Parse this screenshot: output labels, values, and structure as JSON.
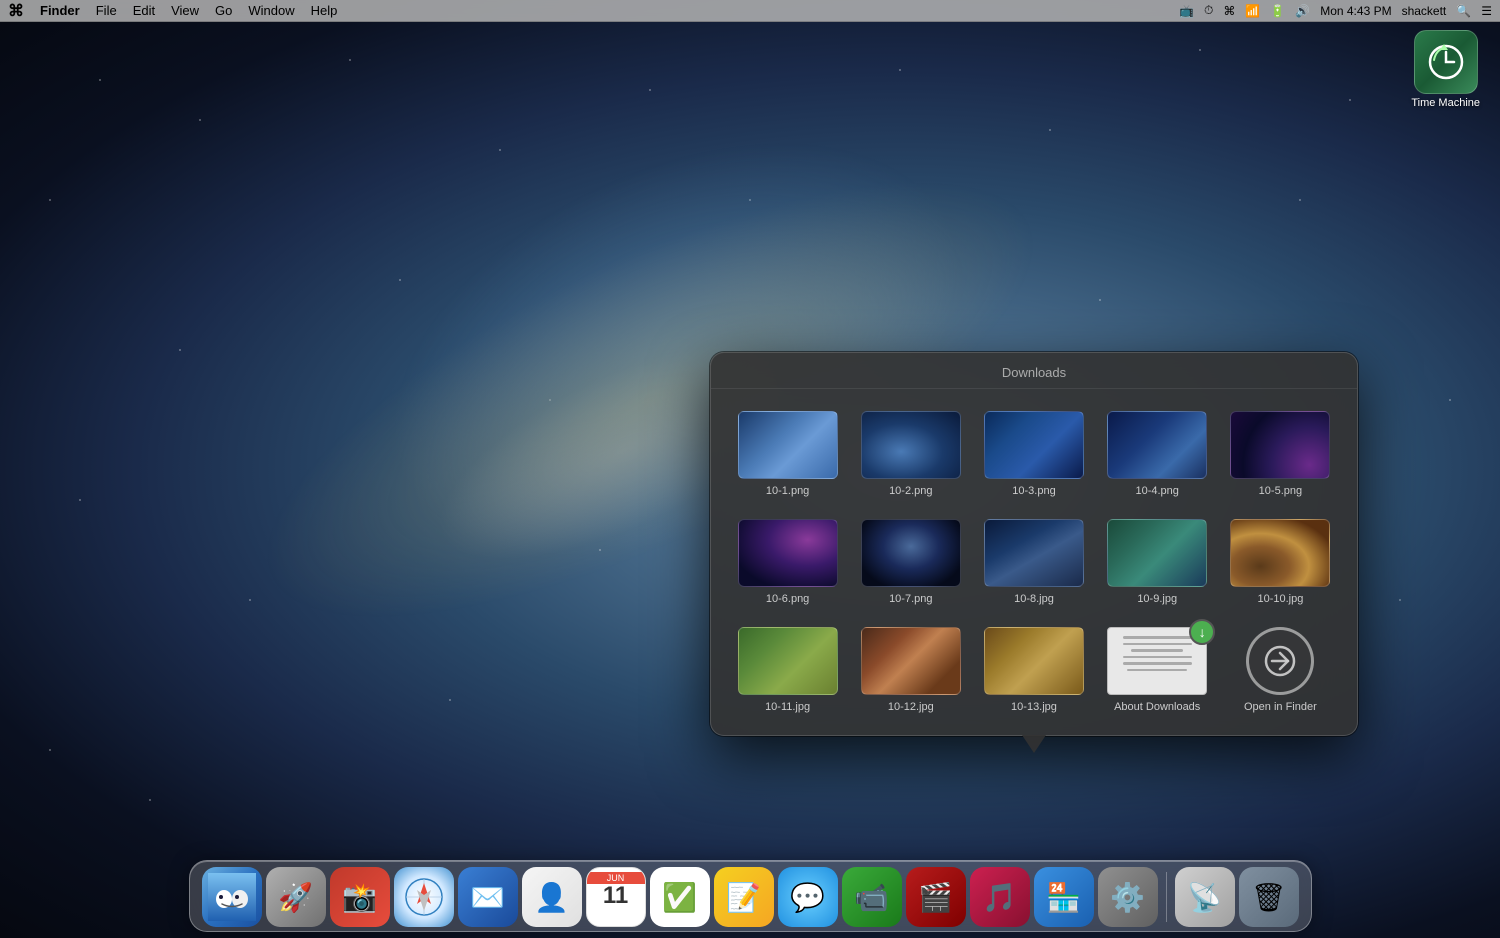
{
  "menubar": {
    "apple": "⌘",
    "finder": "Finder",
    "file": "File",
    "edit": "Edit",
    "view": "View",
    "go": "Go",
    "window": "Window",
    "help": "Help",
    "right_items": [
      "🖥",
      "⏱",
      "⌘",
      "📶",
      "🔋",
      "🔊"
    ],
    "datetime": "Mon 4:43 PM",
    "username": "shackett",
    "search_icon": "🔍",
    "list_icon": "☰"
  },
  "desktop": {
    "time_machine": {
      "label": "Time Machine",
      "icon": "⏰"
    }
  },
  "downloads_popup": {
    "title": "Downloads",
    "files": [
      {
        "name": "10-1.png",
        "thumb_class": "thumb-1"
      },
      {
        "name": "10-2.png",
        "thumb_class": "thumb-2"
      },
      {
        "name": "10-3.png",
        "thumb_class": "thumb-3"
      },
      {
        "name": "10-4.png",
        "thumb_class": "thumb-4"
      },
      {
        "name": "10-5.png",
        "thumb_class": "thumb-5"
      },
      {
        "name": "10-6.png",
        "thumb_class": "thumb-6"
      },
      {
        "name": "10-7.png",
        "thumb_class": "thumb-7"
      },
      {
        "name": "10-8.jpg",
        "thumb_class": "thumb-8"
      },
      {
        "name": "10-9.jpg",
        "thumb_class": "thumb-9"
      },
      {
        "name": "10-10.jpg",
        "thumb_class": "thumb-10"
      },
      {
        "name": "10-11.jpg",
        "thumb_class": "thumb-11"
      },
      {
        "name": "10-12.jpg",
        "thumb_class": "thumb-12"
      },
      {
        "name": "10-13.jpg",
        "thumb_class": "thumb-13"
      },
      {
        "name": "About Downloads",
        "type": "doc"
      },
      {
        "name": "Open in Finder",
        "type": "finder"
      }
    ]
  },
  "dock": {
    "icons": [
      {
        "name": "Finder",
        "class": "finder-icon",
        "emoji": "🖥"
      },
      {
        "name": "Rocket",
        "class": "rocket-icon",
        "emoji": "🚀"
      },
      {
        "name": "Photo Booth",
        "class": "photo-icon",
        "emoji": "📷"
      },
      {
        "name": "Safari",
        "class": "safari-icon",
        "emoji": "🧭"
      },
      {
        "name": "Mail",
        "class": "mail-icon",
        "emoji": "✉️"
      },
      {
        "name": "Contacts",
        "class": "contacts-icon",
        "emoji": "👤"
      },
      {
        "name": "Calendar",
        "class": "calendar-icon",
        "emoji": "📅"
      },
      {
        "name": "Reminders",
        "class": "reminder-icon",
        "emoji": "✅"
      },
      {
        "name": "Notes",
        "class": "notes-icon",
        "emoji": "📝"
      },
      {
        "name": "Messages",
        "class": "messages-icon",
        "emoji": "💬"
      },
      {
        "name": "FaceTime",
        "class": "facetime-icon",
        "emoji": "📹"
      },
      {
        "name": "DVD",
        "class": "dvd-icon",
        "emoji": "🎬"
      },
      {
        "name": "iTunes",
        "class": "itunes-icon",
        "emoji": "🎵"
      },
      {
        "name": "App Store",
        "class": "appstore-icon",
        "emoji": "🏪"
      },
      {
        "name": "System Preferences",
        "class": "syspref-icon",
        "emoji": "⚙️"
      },
      {
        "name": "AirDrop",
        "class": "airdrop-icon",
        "emoji": "📡"
      },
      {
        "name": "Trash",
        "class": "trash-icon",
        "emoji": "🗑"
      }
    ]
  }
}
